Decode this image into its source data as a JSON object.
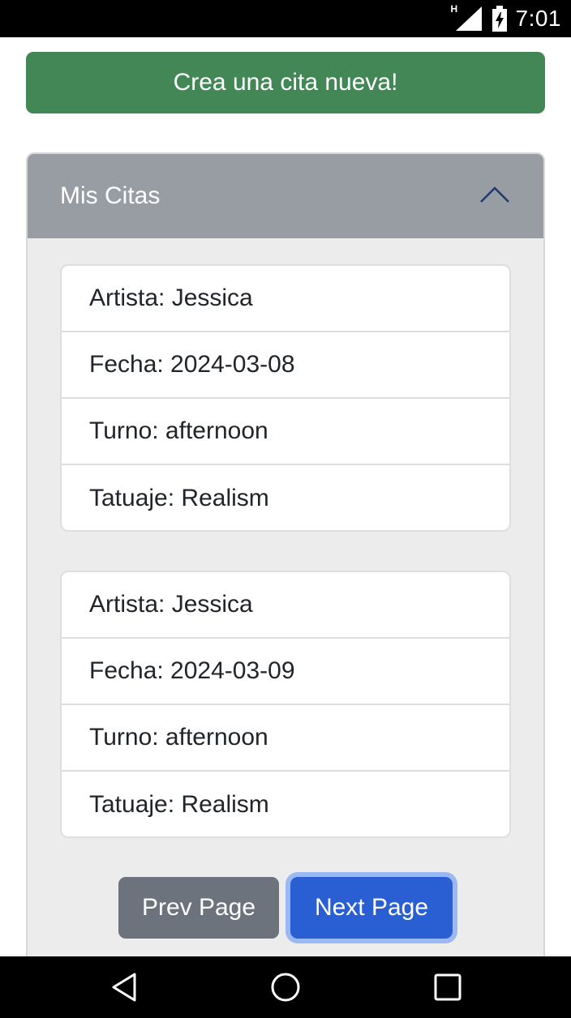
{
  "status_bar": {
    "time": "7:01",
    "network_label": "H",
    "icons": [
      "signal-icon",
      "battery-charging-icon"
    ]
  },
  "create_button": {
    "label": "Crea una cita nueva!"
  },
  "appointments_panel": {
    "title": "Mis Citas",
    "toggle_icon": "chevron-up-icon",
    "items": [
      {
        "artista": "Artista: Jessica",
        "fecha": "Fecha: 2024-03-08",
        "turno": "Turno: afternoon",
        "tatuaje": "Tatuaje: Realism"
      },
      {
        "artista": "Artista: Jessica",
        "fecha": "Fecha: 2024-03-09",
        "turno": "Turno: afternoon",
        "tatuaje": "Tatuaje: Realism"
      }
    ]
  },
  "pagination": {
    "prev_label": "Prev Page",
    "next_label": "Next Page"
  },
  "nav_bar": {
    "icons": [
      "back-icon",
      "home-icon",
      "recents-icon"
    ]
  },
  "colors": {
    "create_button": "#428755",
    "panel_header": "#989ca3",
    "prev_button": "#6c737c",
    "next_button": "#2a5fd3",
    "chevron": "#1e3a6b"
  }
}
